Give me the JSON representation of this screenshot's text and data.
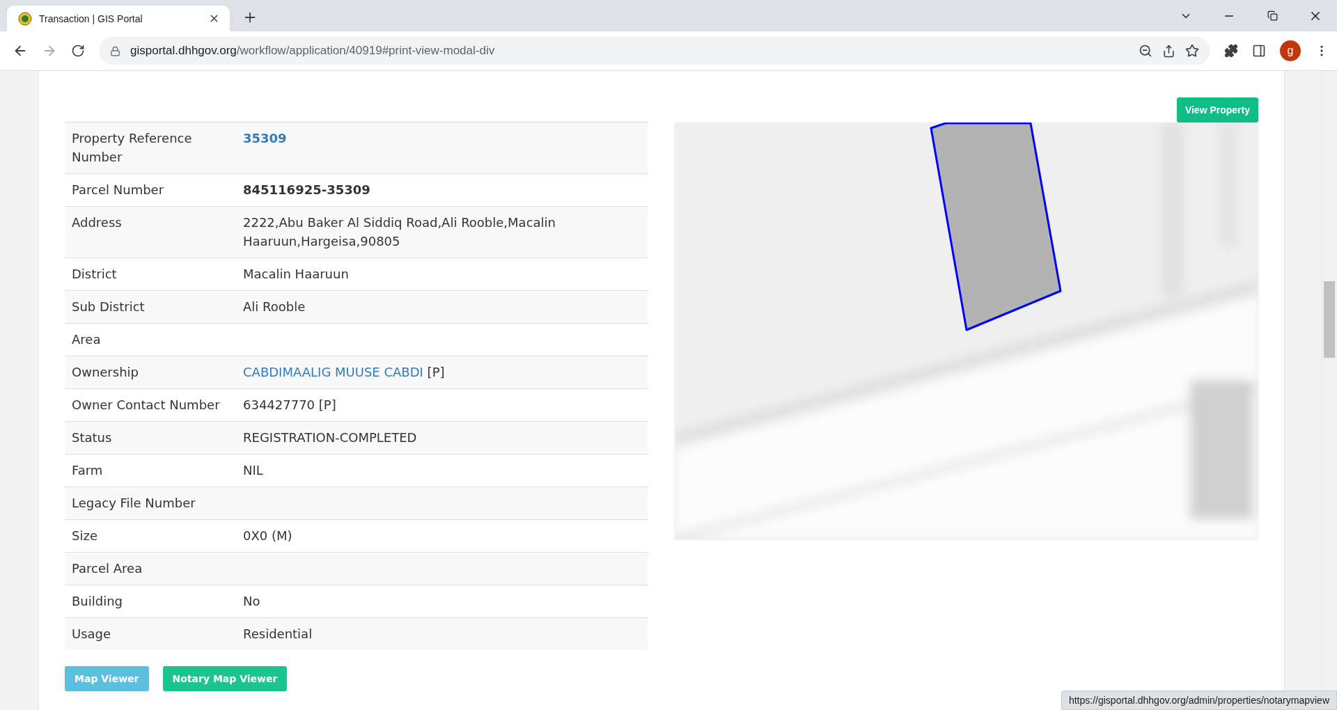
{
  "browser": {
    "tab": {
      "title": "Transaction | GIS Portal",
      "selected": true
    },
    "url_host": "gisportal.dhhgov.org",
    "url_path": "/workflow/application/40919#print-view-modal-div",
    "profile_initial": "g"
  },
  "property_table": [
    {
      "label": "Property Reference Number",
      "kind": "link",
      "value": "35309"
    },
    {
      "label": "Parcel Number",
      "kind": "bold",
      "value": "845116925-35309"
    },
    {
      "label": "Address",
      "kind": "text",
      "value": "2222,Abu Baker Al Siddiq Road,Ali Rooble,Macalin Haaruun,Hargeisa,90805"
    },
    {
      "label": "District",
      "kind": "text",
      "value": "Macalin Haaruun"
    },
    {
      "label": "Sub District",
      "kind": "text",
      "value": "Ali Rooble"
    },
    {
      "label": "Area",
      "kind": "text"
    },
    {
      "label": "Ownership",
      "kind": "link",
      "value": "CABDIMAALIG MUUSE CABDI",
      "suffix": "[P]"
    },
    {
      "label": "Owner Contact Number",
      "kind": "text",
      "value": "634427770 [P]"
    },
    {
      "label": "Status",
      "kind": "text",
      "value": "REGISTRATION-COMPLETED"
    },
    {
      "label": "Farm",
      "kind": "text",
      "value": "NIL"
    },
    {
      "label": "Legacy File Number",
      "kind": "text"
    },
    {
      "label": "Size",
      "kind": "text",
      "value": "0X0 (M)"
    },
    {
      "label": "Parcel Area",
      "kind": "text"
    },
    {
      "label": "Building",
      "kind": "text",
      "value": "No"
    },
    {
      "label": "Usage",
      "kind": "text",
      "value": "Residential"
    }
  ],
  "buttons": [
    {
      "label": "Map Viewer",
      "kind": "info"
    },
    {
      "label": "Notary Map Viewer",
      "kind": "success"
    }
  ],
  "view_property_button": "View Property",
  "status_link": "https://gisportal.dhhgov.org/admin/properties/notarymapview"
}
